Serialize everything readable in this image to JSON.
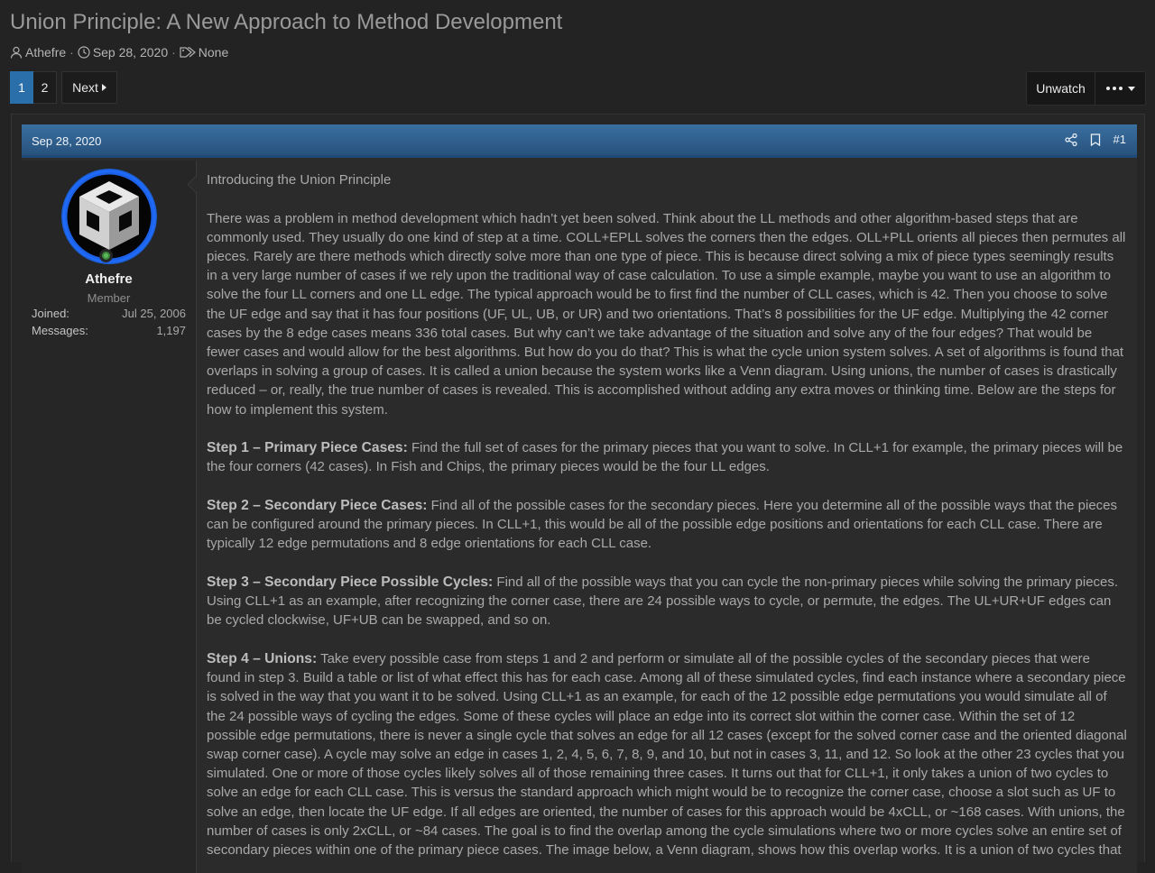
{
  "thread": {
    "title": "Union Principle: A New Approach to Method Development",
    "author": "Athefre",
    "date": "Sep 28, 2020",
    "tags": "None"
  },
  "pagination": {
    "pages": [
      "1",
      "2"
    ],
    "current": "1",
    "next_label": "Next"
  },
  "actions": {
    "unwatch_label": "Unwatch",
    "more_icon": "ellipsis-icon"
  },
  "post": {
    "date": "Sep 28, 2020",
    "number": "#1",
    "icons": [
      "share-icon",
      "bookmark-icon"
    ]
  },
  "user": {
    "name": "Athefre",
    "title": "Member",
    "joined_label": "Joined:",
    "joined_value": "Jul 25, 2006",
    "messages_label": "Messages:",
    "messages_value": "1,197",
    "status": "online"
  },
  "content": {
    "intro": "Introducing the Union Principle",
    "para1": "There was a problem in method development which hadn’t yet been solved. Think about the LL methods and other algorithm-based steps that are commonly used. They usually do one kind of step at a time. COLL+EPLL solves the corners then the edges. OLL+PLL orients all pieces then permutes all pieces. Rarely are there methods which directly solve more than one type of piece. This is because direct solving a mix of piece types seemingly results in a very large number of cases if we rely upon the traditional way of case calculation. To use a simple example, maybe you want to use an algorithm to solve the four LL corners and one LL edge. The typical approach would be to first find the number of CLL cases, which is 42. Then you choose to solve the UF edge and say that it has four positions (UF, UL, UB, or UR) and two orientations. That’s 8 possibilities for the UF edge. Multiplying the 42 corner cases by the 8 edge cases means 336 total cases. But why can’t we take advantage of the situation and solve any of the four edges? That would be fewer cases and would allow for the best algorithms. But how do you do that? This is what the cycle union system solves. A set of algorithms is found that overlaps in solving a group of cases. It is called a union because the system works like a Venn diagram. Using unions, the number of cases is drastically reduced – or, really, the true number of cases is revealed. This is accomplished without adding any extra moves or thinking time. Below are the steps for how to implement this system.",
    "step1_head": "Step 1 – Primary Piece Cases:",
    "step1_text": " Find the full set of cases for the primary pieces that you want to solve. In CLL+1 for example, the primary pieces will be the four corners (42 cases). In Fish and Chips, the primary pieces would be the four LL edges.",
    "step2_head": "Step 2 – Secondary Piece Cases:",
    "step2_text": " Find all of the possible cases for the secondary pieces. Here you determine all of the possible ways that the pieces can be configured around the primary pieces. In CLL+1, this would be all of the possible edge positions and orientations for each CLL case. There are typically 12 edge permutations and 8 edge orientations for each CLL case.",
    "step3_head": "Step 3 – Secondary Piece Possible Cycles:",
    "step3_text": " Find all of the possible ways that you can cycle the non-primary pieces while solving the primary pieces. Using CLL+1 as an example, after recognizing the corner case, there are 24 possible ways to cycle, or permute, the edges. The UL+UR+UF edges can be cycled clockwise, UF+UB can be swapped, and so on.",
    "step4_head": "Step 4 – Unions:",
    "step4_text": " Take every possible case from steps 1 and 2 and perform or simulate all of the possible cycles of the secondary pieces that were found in step 3. Build a table or list of what effect this has for each case. Among all of these simulated cycles, find each instance where a secondary piece is solved in the way that you want it to be solved. Using CLL+1 as an example, for each of the 12 possible edge permutations you would simulate all of the 24 possible ways of cycling the edges. Some of these cycles will place an edge into its correct slot within the corner case. Within the set of 12 possible edge permutations, there is never a single cycle that solves an edge for all 12 cases (except for the solved corner case and the oriented diagonal swap corner case). A cycle may solve an edge in cases 1, 2, 4, 5, 6, 7, 8, 9, and 10, but not in cases 3, 11, and 12. So look at the other 23 cycles that you simulated. One or more of those cycles likely solves all of those remaining three cases. It turns out that for CLL+1, it only takes a union of two cycles to solve an edge for each CLL case. This is versus the standard approach which might would be to recognize the corner case, choose a slot such as UF to solve an edge, then locate the UF edge. If all edges are oriented, the number of cases for this approach would be 4xCLL, or ~168 cases. With unions, the number of cases is only 2xCLL, or ~84 cases. The goal is to find the overlap among the cycle simulations where two or more cycles solve an entire set of secondary pieces within one of the primary piece cases. The image below, a Venn diagram, shows how this overlap works. It is a union of two cycles that"
  }
}
